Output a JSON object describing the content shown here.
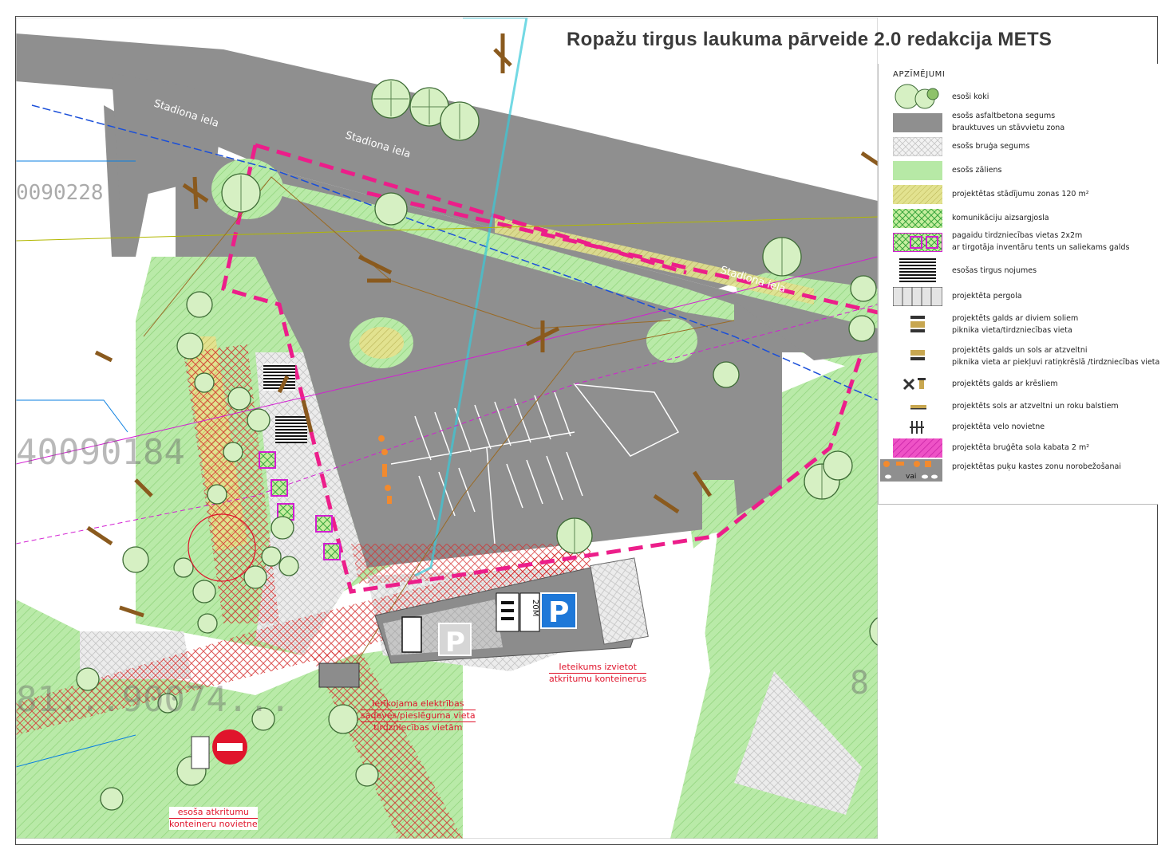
{
  "title": "Ropažu tirgus laukuma pārveide 2.0 redakcija METS",
  "legend": {
    "heading": "APZĪMĒJUMI",
    "items": [
      {
        "id": "trees",
        "lines": [
          "esoši koki"
        ]
      },
      {
        "id": "asphalt",
        "lines": [
          "esošs asfaltbetona segums",
          "brauktuves un stāvvietu zona"
        ]
      },
      {
        "id": "paving",
        "lines": [
          "esošs bruģa segums"
        ]
      },
      {
        "id": "lawn",
        "lines": [
          "esošs zāliens"
        ]
      },
      {
        "id": "planting",
        "lines": [
          "projektētas stādījumu zonas  120 m²"
        ]
      },
      {
        "id": "utility",
        "lines": [
          "komunikāciju aizsargjosla"
        ]
      },
      {
        "id": "market",
        "lines": [
          "pagaidu tirdzniecības vietas 2x2m",
          "ar tirgotāja inventāru tents un saliekams galds"
        ]
      },
      {
        "id": "canopy",
        "lines": [
          "esošas tirgus nojumes"
        ]
      },
      {
        "id": "pergola",
        "lines": [
          "projektēta pergola"
        ]
      },
      {
        "id": "table2",
        "lines": [
          "projektēts galds ar diviem soliem",
          "piknika vieta/tirdzniecības vieta"
        ]
      },
      {
        "id": "table1",
        "lines": [
          "projektēts galds un sols ar atzveltni",
          "piknika vieta ar piekļuvi ratiņkrēslā /tirdzniecības vieta"
        ]
      },
      {
        "id": "chairs",
        "lines": [
          "projektēts galds ar krēsliem"
        ]
      },
      {
        "id": "bench",
        "lines": [
          "projektēts sols ar atzveltni un roku balstiem"
        ]
      },
      {
        "id": "bike",
        "lines": [
          "projektēta velo novietne"
        ]
      },
      {
        "id": "pocket",
        "lines": [
          "projektēta bruģēta sola kabata  2 m²"
        ]
      },
      {
        "id": "flower",
        "lines": [
          "projektētas puķu kastes zonu norobežošanai"
        ]
      }
    ],
    "flower_swatch_text": "vai"
  },
  "streets": [
    "Stadiona iela",
    "Stadiona iela",
    "Stadiona iela"
  ],
  "parcels": [
    "0090228",
    "40090184",
    "81...90074...",
    "8"
  ],
  "labels": {
    "electric": [
      "Ierīkojama elektrības",
      "sadeves/pieslēguma vieta",
      "tirdzniecības vietām"
    ],
    "containers_new": [
      "Ieteikums izvietot",
      "atkritumu konteinerus"
    ],
    "containers_old": [
      "esoša atkritumu",
      "konteineru novietne"
    ]
  },
  "signs": {
    "parking": "P",
    "parking_small": "P",
    "distance": "20M"
  },
  "colors": {
    "asphalt": "#8f8f8f",
    "lawn": "#b7e9a6",
    "lawn_dark": "#9fdc8a",
    "planting": "#dfe08d",
    "paving": "#e6e6e6",
    "pink": "#ec1e8a",
    "red": "#e0142c",
    "blue": "#1a73d9",
    "brown": "#8a5a1e"
  }
}
